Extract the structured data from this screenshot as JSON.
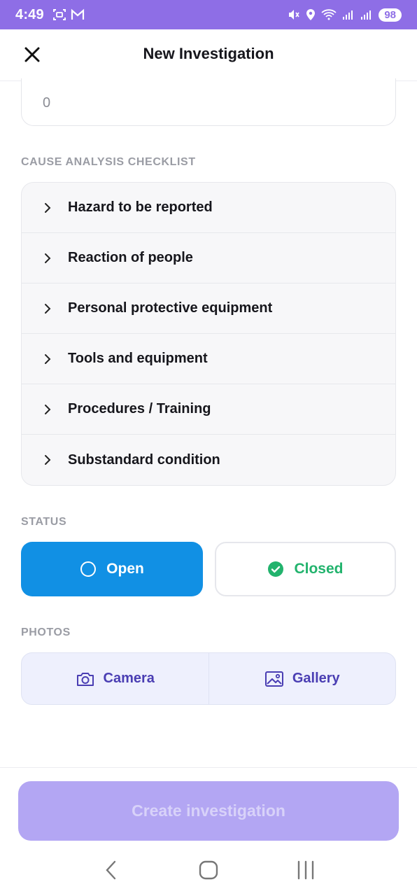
{
  "status_bar": {
    "time": "4:49",
    "battery": "98"
  },
  "header": {
    "title": "New Investigation"
  },
  "form": {
    "number_value": "0"
  },
  "cause_analysis": {
    "label": "CAUSE ANALYSIS CHECKLIST",
    "items": [
      {
        "label": "Hazard to be reported"
      },
      {
        "label": "Reaction of people"
      },
      {
        "label": "Personal protective equipment"
      },
      {
        "label": "Tools and equipment"
      },
      {
        "label": "Procedures / Training"
      },
      {
        "label": "Substandard condition"
      }
    ]
  },
  "status": {
    "label": "STATUS",
    "open_label": "Open",
    "closed_label": "Closed",
    "selected": "Open"
  },
  "photos": {
    "label": "PHOTOS",
    "camera_label": "Camera",
    "gallery_label": "Gallery"
  },
  "footer": {
    "create_label": "Create investigation"
  },
  "colors": {
    "accent": "#8e6ee6",
    "open_blue": "#1190e4",
    "closed_green": "#22b36d",
    "photo_text": "#4a3eb3"
  }
}
